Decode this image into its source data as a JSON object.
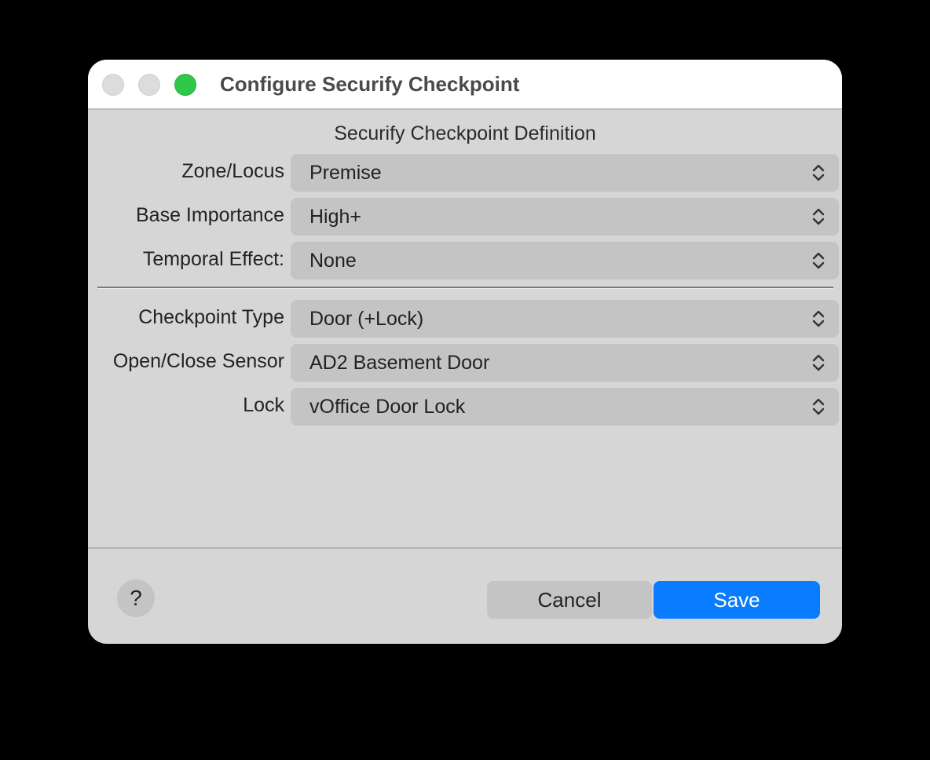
{
  "window": {
    "title": "Configure Securify Checkpoint"
  },
  "section_heading": "Securify Checkpoint Definition",
  "fields": [
    {
      "label": "Zone/Locus",
      "value": "Premise"
    },
    {
      "label": "Base Importance",
      "value": "High+"
    },
    {
      "label": "Temporal Effect:",
      "value": "None"
    },
    {
      "label": "Checkpoint Type",
      "value": "Door (+Lock)"
    },
    {
      "label": "Open/Close Sensor",
      "value": "AD2 Basement Door"
    },
    {
      "label": "Lock",
      "value": "vOffice Door Lock"
    }
  ],
  "footer": {
    "help_label": "?",
    "cancel_label": "Cancel",
    "save_label": "Save"
  },
  "colors": {
    "accent": "#0a7cff",
    "zoom_light": "#2fc84a",
    "window_bg": "#d6d6d6"
  },
  "icons": {
    "popup_chevron": "chevron-up-down-icon"
  }
}
